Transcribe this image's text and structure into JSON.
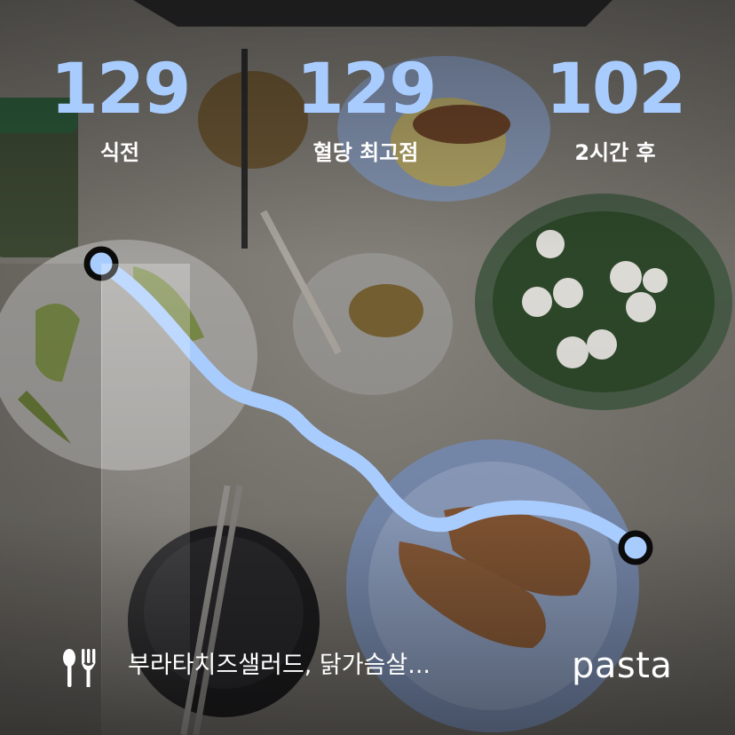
{
  "stats": [
    {
      "value": "129",
      "label": "식전"
    },
    {
      "value": "129",
      "label": "혈당 최고점"
    },
    {
      "value": "102",
      "label": "2시간 후"
    }
  ],
  "meal": {
    "icon": "fork-and-spoon-icon",
    "text": "부라타치즈샐러드, 닭가슴살..."
  },
  "brand": {
    "name": "pasta"
  },
  "colors": {
    "accent": "#a9ccff",
    "line": "#a9ccff",
    "text": "#ffffff"
  }
}
